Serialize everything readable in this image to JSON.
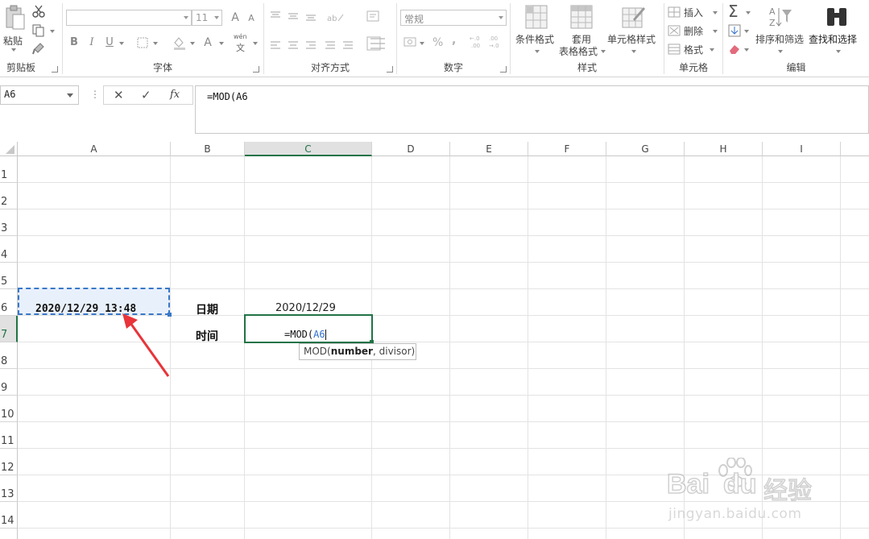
{
  "ribbon": {
    "clipboard": {
      "paste_label": "粘贴",
      "group_label": "剪贴板"
    },
    "font": {
      "font_name": "",
      "font_size": "11",
      "bold": "B",
      "italic": "I",
      "underline": "U",
      "grow_font": "A",
      "shrink_font": "A",
      "font_color": "A",
      "phonetic_top": "wén",
      "phonetic_bottom": "文",
      "group_label": "字体"
    },
    "alignment": {
      "group_label": "对齐方式"
    },
    "number": {
      "format": "常规",
      "percent": "%",
      "comma": ",",
      "group_label": "数字"
    },
    "styles": {
      "conditional_format": "条件格式",
      "table_format_line1": "套用",
      "table_format_line2": "表格格式",
      "cell_styles": "单元格样式",
      "group_label": "样式"
    },
    "cells": {
      "insert": "插入",
      "delete": "删除",
      "format": "格式",
      "group_label": "单元格"
    },
    "editing": {
      "sort_filter": "排序和筛选",
      "find_select": "查找和选择",
      "group_label": "编辑"
    }
  },
  "formula_bar": {
    "name_box": "A6",
    "cancel_icon": "✕",
    "enter_icon": "✓",
    "fx_label": "fx",
    "formula": "=MOD(A6"
  },
  "grid": {
    "columns": [
      "A",
      "B",
      "C",
      "D",
      "E",
      "F",
      "G",
      "H",
      "I"
    ],
    "active_column": "C",
    "rows": [
      "1",
      "2",
      "3",
      "4",
      "5",
      "6",
      "7",
      "8",
      "9",
      "10",
      "11",
      "12",
      "13",
      "14"
    ],
    "active_row": "7",
    "cells": {
      "A6": "2020/12/29 13:48",
      "B6": "日期",
      "C6": "2020/12/29",
      "B7": "时间",
      "C7_prefix": "=MOD(",
      "C7_ref": "A6"
    },
    "tooltip": {
      "func": "MOD(",
      "arg1": "number",
      "rest": ", divisor)"
    }
  },
  "watermark": {
    "line1": "Bai",
    "line2": "du",
    "line3": "经验",
    "url": "jingyan.baidu.com"
  },
  "colors": {
    "accent": "#217346",
    "ref_blue": "#2f6fd0",
    "selection_fill": "#e8f0fb",
    "arrow_red": "#e8343a"
  }
}
